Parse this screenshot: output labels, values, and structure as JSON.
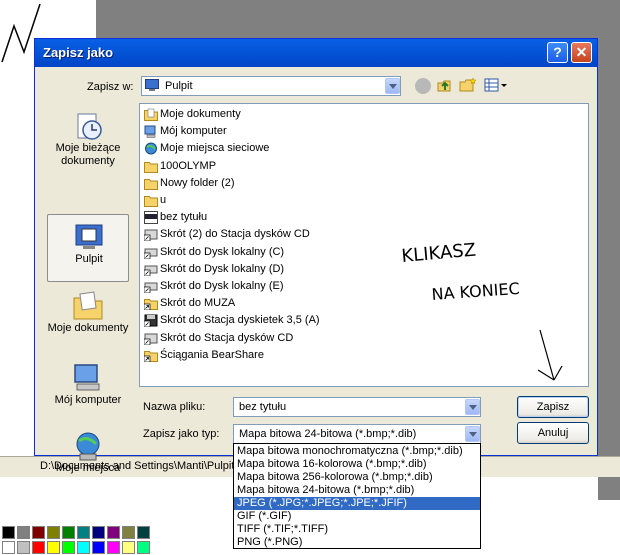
{
  "dialog": {
    "title": "Zapisz jako",
    "help_label": "?",
    "close_label": "✕",
    "save_in_label": "Zapisz w:",
    "save_in_value": "Pulpit",
    "places": [
      {
        "label": "Moje bieżące dokumenty",
        "icon": "recent-documents-icon"
      },
      {
        "label": "Pulpit",
        "icon": "desktop-icon"
      },
      {
        "label": "Moje dokumenty",
        "icon": "my-documents-icon"
      },
      {
        "label": "Mój komputer",
        "icon": "my-computer-icon"
      },
      {
        "label": "Moje miejsca",
        "icon": "network-places-icon"
      }
    ],
    "files": [
      {
        "name": "Moje dokumenty",
        "icon": "my-documents-icon"
      },
      {
        "name": "Mój komputer",
        "icon": "my-computer-icon"
      },
      {
        "name": "Moje miejsca sieciowe",
        "icon": "network-places-icon"
      },
      {
        "name": "100OLYMP",
        "icon": "folder-icon"
      },
      {
        "name": "Nowy folder (2)",
        "icon": "folder-icon"
      },
      {
        "name": "u",
        "icon": "folder-icon"
      },
      {
        "name": "bez tytułu",
        "icon": "bitmap-file-icon"
      },
      {
        "name": "Skrót (2) do Stacja dysków CD",
        "icon": "cd-shortcut-icon"
      },
      {
        "name": "Skrót do Dysk lokalny (C)",
        "icon": "drive-shortcut-icon"
      },
      {
        "name": "Skrót do Dysk lokalny (D)",
        "icon": "drive-shortcut-icon"
      },
      {
        "name": "Skrót do Dysk lokalny (E)",
        "icon": "drive-shortcut-icon"
      },
      {
        "name": "Skrót do MUZA",
        "icon": "folder-shortcut-icon"
      },
      {
        "name": "Skrót do Stacja dyskietek 3,5 (A)",
        "icon": "floppy-shortcut-icon"
      },
      {
        "name": "Skrót do Stacja dysków CD",
        "icon": "cd-shortcut-icon"
      },
      {
        "name": "Ściągania BearShare",
        "icon": "folder-shortcut-icon"
      }
    ],
    "filename_label": "Nazwa pliku:",
    "filename_value": "bez tytułu",
    "type_label": "Zapisz jako typ:",
    "type_value": "Mapa bitowa 24-bitowa (*.bmp;*.dib)",
    "save_button": "Zapisz",
    "cancel_button": "Anuluj",
    "type_options": [
      "Mapa bitowa monochromatyczna (*.bmp;*.dib)",
      "Mapa bitowa 16-kolorowa  (*.bmp;*.dib)",
      "Mapa bitowa 256-kolorowa (*.bmp;*.dib)",
      "Mapa bitowa 24-bitowa (*.bmp;*.dib)",
      "JPEG (*.JPG;*.JPEG;*.JPE;*.JFIF)",
      "GIF (*.GIF)",
      "TIFF (*.TIF;*.TIFF)",
      "PNG (*.PNG)"
    ],
    "type_selected_index": 4
  },
  "status_bar": {
    "path": "D:\\Documents and Settings\\Manti\\Pulpit"
  },
  "handwritten_note": {
    "line1": "KLIKASZ",
    "line2": "NA KONIEC"
  },
  "palette_colors": [
    "#000000",
    "#808080",
    "#800000",
    "#808000",
    "#008000",
    "#008080",
    "#000080",
    "#800080",
    "#808040",
    "#004040",
    "#ffffff",
    "#c0c0c0",
    "#ff0000",
    "#ffff00",
    "#00ff00",
    "#00ffff",
    "#0000ff",
    "#ff00ff",
    "#ffff80",
    "#00ff80"
  ]
}
